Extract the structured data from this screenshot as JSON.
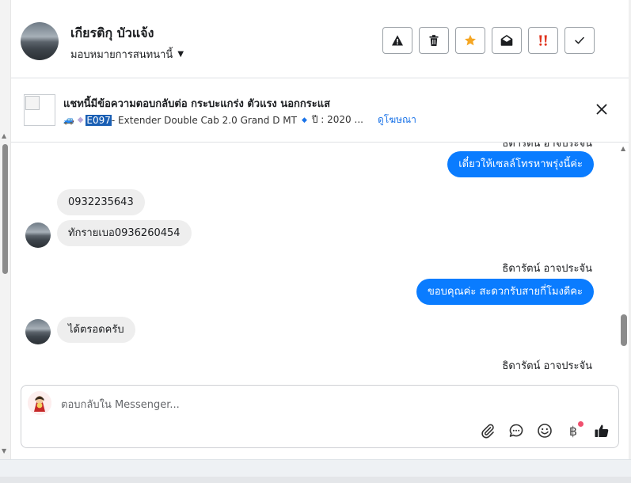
{
  "header": {
    "contact_name": "เกียรติกุ บัวแจ้ง",
    "assign_label": "มอบหมายการสนทนานี้",
    "action_icons": [
      "warning-icon",
      "trash-icon",
      "star-icon",
      "mail-open-icon",
      "urgent-icon",
      "check-icon"
    ],
    "accent": "#f5a623",
    "urgent_color": "#e0321c"
  },
  "listing": {
    "title": "แชทนี้มีข้อความตอบกลับต่อ กระบะแกร่ง ตัวแรง นอกกระแส",
    "code": "E097",
    "model": " - Extender Double Cab 2.0 Grand D MT",
    "year": "ปี : 2020 ...",
    "view_ad": "ดูโฆษณา"
  },
  "chat": {
    "messages": [
      {
        "dir": "out",
        "sender": "ธิดารัตน์ อาจประจัน",
        "text": "เดี๋ยวให้เซลล์โทรหาพรุ่งนี้ค่ะ"
      },
      {
        "dir": "in",
        "text": "0932235643"
      },
      {
        "dir": "in",
        "text": "ทักรายเบอ0936260454"
      },
      {
        "dir": "out",
        "sender": "ธิดารัตน์ อาจประจัน",
        "text": "ขอบคุณค่ะ สะดวกรับสายกี่โมงดีคะ"
      },
      {
        "dir": "in",
        "text": "ได้ตรอดครับ"
      },
      {
        "dir": "out",
        "sender": "ธิดารัตน์ อาจประจัน",
        "text": ""
      }
    ],
    "outgoing_color": "#0a7cff",
    "incoming_color": "#eeeeee"
  },
  "composer": {
    "placeholder": "ตอบกลับใน Messenger...",
    "value": "",
    "currency_symbol": "฿",
    "tool_icons": [
      "paperclip-icon",
      "chat-bubble-icon",
      "emoji-icon",
      "baht-icon",
      "thumbs-up-icon"
    ]
  }
}
